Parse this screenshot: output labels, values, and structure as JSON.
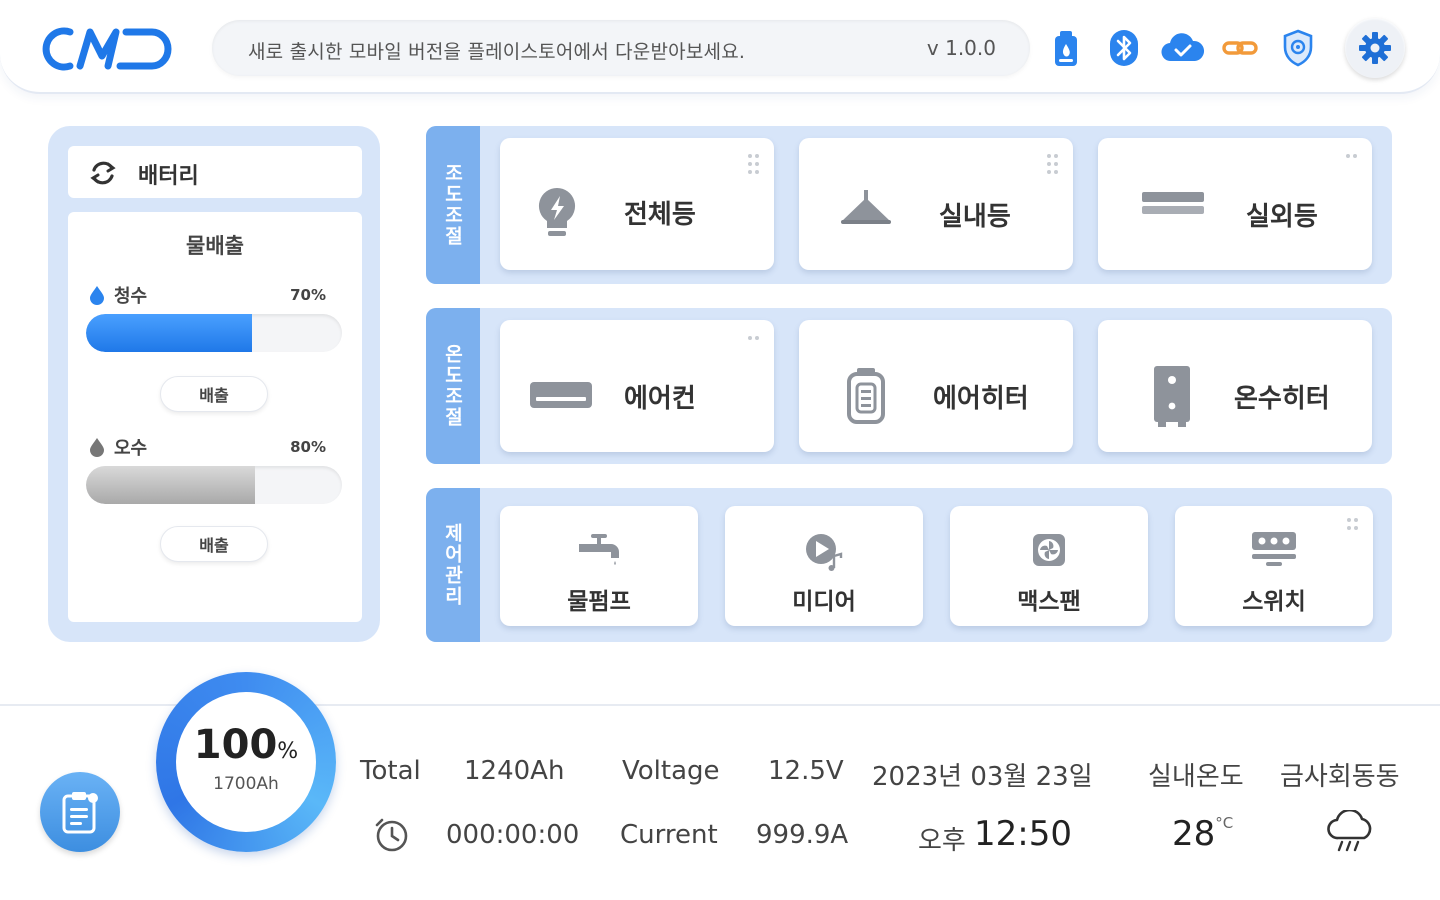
{
  "header": {
    "logo_text": "CMD",
    "notice": "새로 출시한 모바일 버전을 플레이스토어에서 다운받아보세요.",
    "version": "v 1.0.0",
    "icons": [
      "gas-icon",
      "bluetooth-icon",
      "cloud-check-icon",
      "link-icon",
      "shield-icon",
      "gear-icon"
    ],
    "accent_color": "#1f78e8",
    "link_color": "#f29a3a"
  },
  "battery": {
    "title": "배터리",
    "drain_title": "물배출",
    "tanks": [
      {
        "label": "청수",
        "percent_text": "70%",
        "level": 0.65,
        "button": "배출"
      },
      {
        "label": "오수",
        "percent_text": "80%",
        "level": 0.66,
        "button": "배출"
      }
    ]
  },
  "groups": [
    {
      "tab": "조도조절",
      "items": [
        "전체등",
        "실내등",
        "실외등"
      ]
    },
    {
      "tab": "온도조절",
      "items": [
        "에어컨",
        "에어히터",
        "온수히터"
      ]
    },
    {
      "tab": "제어관리",
      "items": [
        "물펌프",
        "미디어",
        "맥스팬",
        "스위치"
      ]
    }
  ],
  "status": {
    "battery_percent": "100",
    "percent_sign": "%",
    "capacity": "1700Ah",
    "total_label": "Total",
    "total_value": "1240Ah",
    "voltage_label": "Voltage",
    "voltage_value": "12.5V",
    "timer": "000:00:00",
    "current_label": "Current",
    "current_value": "999.9A",
    "date": "2023년 03월 23일",
    "ampm": "오후",
    "time": "12:50",
    "indoor_label": "실내온도",
    "temperature": "28",
    "temp_unit": "°C",
    "location": "금사회동동"
  }
}
